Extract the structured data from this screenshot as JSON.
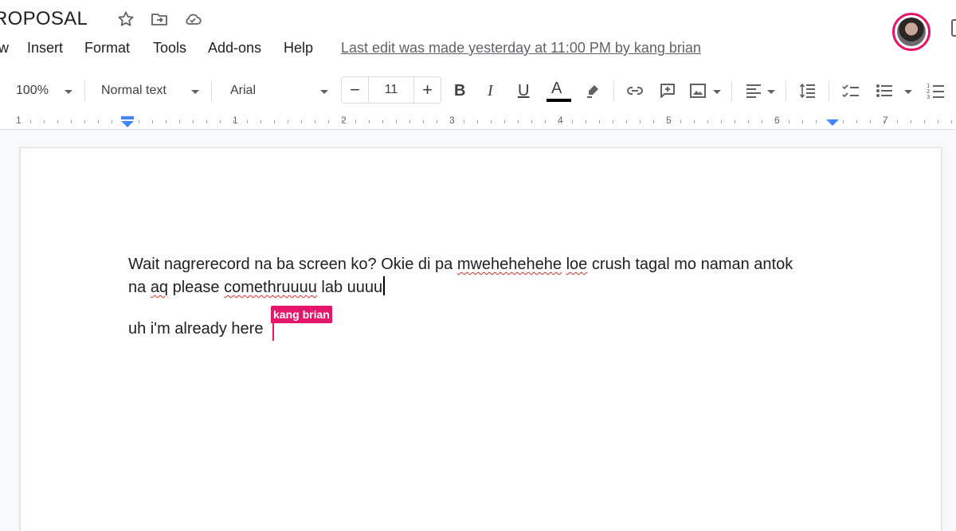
{
  "title_bar": {
    "doc_title": "ROPOSAL",
    "icons": [
      "star-icon",
      "move-folder-icon",
      "cloud-status-icon"
    ]
  },
  "menu": {
    "items": [
      "w",
      "Insert",
      "Format",
      "Tools",
      "Add-ons",
      "Help"
    ],
    "last_edit": "Last edit was made yesterday at 11:00 PM by kang brian"
  },
  "toolbar": {
    "zoom": "100%",
    "style": "Normal text",
    "font": "Arial",
    "font_size": "11",
    "minus": "−",
    "plus": "+",
    "bold": "B",
    "italic": "I",
    "underline": "U",
    "text_color_label": "A"
  },
  "ruler": {
    "numbers": [
      "1",
      "1",
      "2",
      "3",
      "4",
      "5",
      "6",
      "7"
    ]
  },
  "document": {
    "line1_a": "Wait nagrerecord na ba screen ko? Okie di pa ",
    "line1_spell1": "mwehehehehe",
    "line1_b": " ",
    "line1_spell2": "loe",
    "line1_c": " crush tagal mo naman antok",
    "line2_a": "na ",
    "line2_spell1": "aq",
    "line2_b": " please ",
    "line2_spell2": "comethruuuu",
    "line2_c": " lab uuuu",
    "para2": "uh i'm already here"
  },
  "collaborator": {
    "name": "kang brian",
    "color": "#e3166a"
  },
  "colors": {
    "accent": "#1a73e8",
    "spellcheck": "#d93025",
    "text_color_bar": "#000000"
  }
}
